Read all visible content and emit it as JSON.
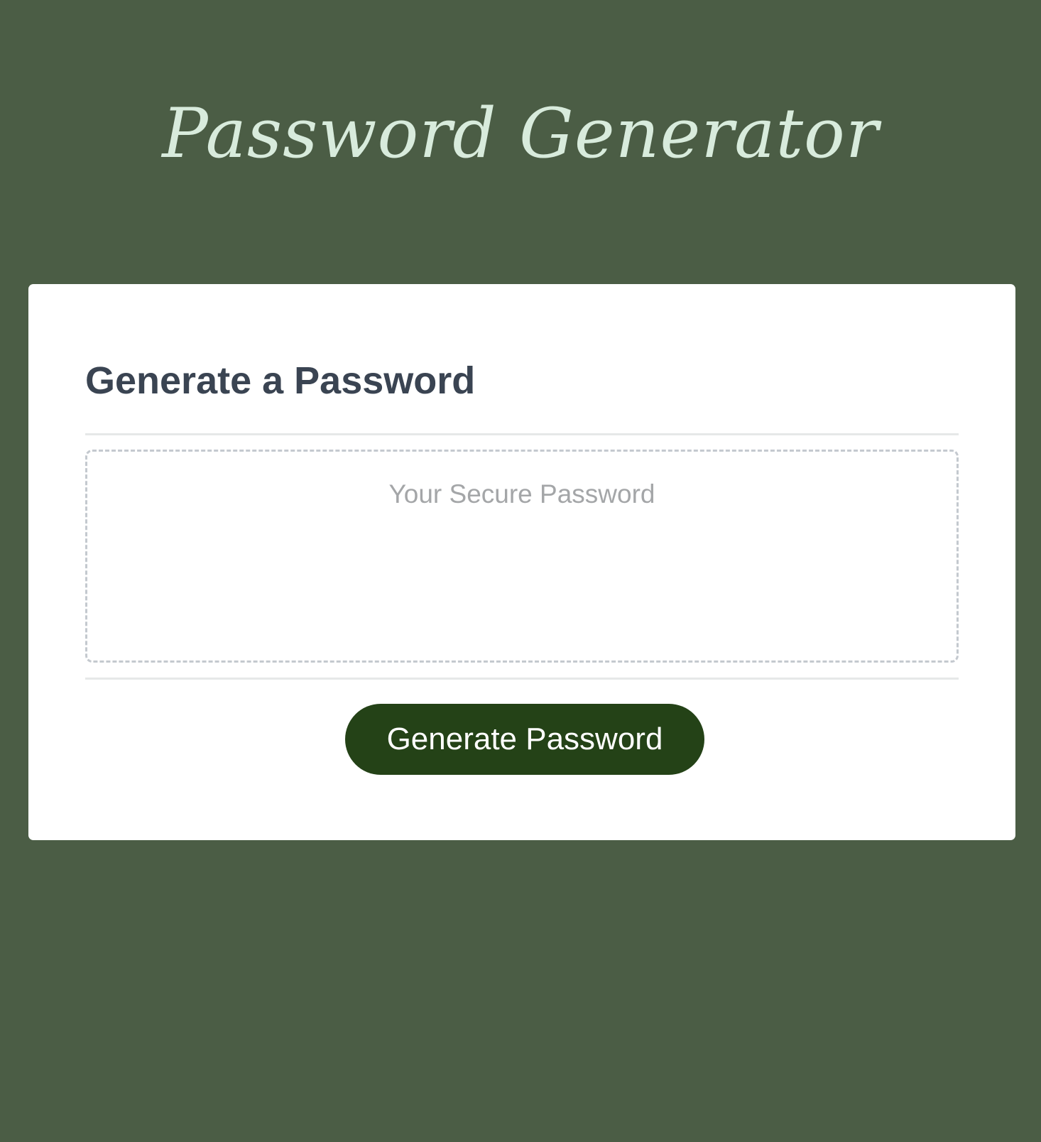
{
  "header": {
    "title": "Password Generator"
  },
  "card": {
    "title": "Generate a Password",
    "password_field": {
      "value": "",
      "placeholder": "Your Secure Password"
    },
    "generate_button_label": "Generate Password"
  },
  "colors": {
    "page_background": "#4b5d45",
    "title_text": "#d8ebdc",
    "card_background": "#ffffff",
    "card_title_text": "#3a4452",
    "button_background": "#244217",
    "button_text": "#ffffff",
    "placeholder_text": "#a4a6a8",
    "dashed_border": "#c4c9cf"
  }
}
